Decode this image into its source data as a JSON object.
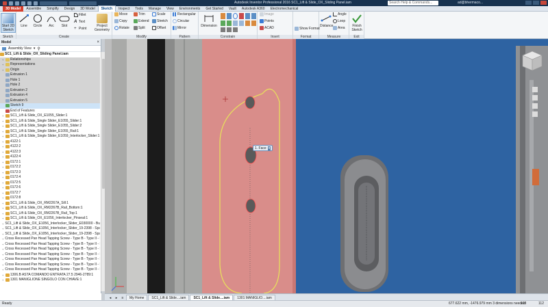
{
  "title_bar": {
    "title": "Autodesk Inventor Professional 2016  SC1_Lift & Slide_OX_Sliding Panel.iam",
    "search_placeholder": "Search Help & Commands...",
    "user": "ad@bhermaco..."
  },
  "ribbon_tabs": [
    "3D Model",
    "Assemble",
    "Simplify",
    "Design",
    "3D Model",
    "Sketch",
    "Inspect",
    "Tools",
    "Manage",
    "View",
    "Environments",
    "Get Started",
    "Vault",
    "Autodesk A360",
    "Electromechanical"
  ],
  "active_tab_index": 5,
  "panels": {
    "sketch": {
      "label": "Sketch",
      "start_button": "Start 2D Sketch"
    },
    "create": {
      "label": "Create",
      "line": "Line",
      "circle": "Circle",
      "arc": "Arc",
      "slot": "Slot",
      "fillet": "Fillet",
      "text": "Text",
      "point": "Point",
      "project_geometry": "Project Geometry"
    },
    "modify": {
      "label": "Modify",
      "move": "Move",
      "copy": "Copy",
      "rotate": "Rotate",
      "trim": "Trim",
      "extend": "Extend",
      "split": "Split",
      "scale": "Scale",
      "stretch": "Stretch",
      "offset": "Offset"
    },
    "pattern": {
      "label": "Pattern",
      "rectangular": "Rectangular",
      "circular": "Circular",
      "mirror": "Mirror"
    },
    "constrain": {
      "label": "Constrain",
      "dimension": "Dimension"
    },
    "insert": {
      "label": "Insert",
      "image": "Image",
      "points": "Points",
      "acad": "ACAD"
    },
    "format": {
      "label": "Format",
      "show_format": "Show Format"
    },
    "measure": {
      "label": "Measure",
      "distance": "Distance",
      "angle": "Angle",
      "loop": "Loop",
      "area": "Area"
    },
    "exit": {
      "label": "Exit",
      "finish": "Finish Sketch"
    }
  },
  "browser": {
    "panel_title": "Model",
    "view_dropdown": "Assembly View",
    "root": "SC1_Lift & Slide_OX_Sliding Panel.iam",
    "items": [
      {
        "label": "Relationships",
        "level": 1,
        "icon": "folder"
      },
      {
        "label": "Representations",
        "level": 1,
        "icon": "folder"
      },
      {
        "label": "Origin",
        "level": 1,
        "icon": "folder"
      },
      {
        "label": "Extrusion 1",
        "level": 1,
        "icon": "extrusion"
      },
      {
        "label": "Hole 1",
        "level": 1,
        "icon": "hole"
      },
      {
        "label": "Hole 2",
        "level": 1,
        "icon": "hole"
      },
      {
        "label": "Extrusion 2",
        "level": 1,
        "icon": "extrusion"
      },
      {
        "label": "Extrusion 4",
        "level": 1,
        "icon": "extrusion"
      },
      {
        "label": "Extrusion 5",
        "level": 1,
        "icon": "extrusion"
      },
      {
        "label": "Sketch 9",
        "level": 1,
        "icon": "sketch",
        "selected": true
      },
      {
        "label": "End of Features",
        "level": 1,
        "icon": "end"
      },
      {
        "label": "SC1_Lift & Slide_OX_E1055_Slider:1",
        "level": 1,
        "icon": "part"
      },
      {
        "label": "SC1_Lift & Slide_Single Slider_E1055_Slider:1",
        "level": 1,
        "icon": "part"
      },
      {
        "label": "SC1_Lift & Slide_Single Slider_E1055_Slider:2",
        "level": 1,
        "icon": "part"
      },
      {
        "label": "SC1_Lift & Slide_Single Slider_E1055_Rail:1",
        "level": 1,
        "icon": "part"
      },
      {
        "label": "SC1_Lift & Slide_Single Slider_E1059_Interlocker_Slider:1",
        "level": 1,
        "icon": "part"
      },
      {
        "label": "4122:1",
        "level": 1,
        "icon": "part"
      },
      {
        "label": "4122:2",
        "level": 1,
        "icon": "part"
      },
      {
        "label": "4122:3",
        "level": 1,
        "icon": "part"
      },
      {
        "label": "4122:4",
        "level": 1,
        "icon": "part"
      },
      {
        "label": "0172:1",
        "level": 1,
        "icon": "part"
      },
      {
        "label": "0172:2",
        "level": 1,
        "icon": "part"
      },
      {
        "label": "0172:3",
        "level": 1,
        "icon": "part"
      },
      {
        "label": "0172:4",
        "level": 1,
        "icon": "part"
      },
      {
        "label": "0172:5",
        "level": 1,
        "icon": "part"
      },
      {
        "label": "0172:6",
        "level": 1,
        "icon": "part"
      },
      {
        "label": "0172:7",
        "level": 1,
        "icon": "part"
      },
      {
        "label": "0172:8",
        "level": 1,
        "icon": "part"
      },
      {
        "label": "SC1_Lift & Slide_OX_RM2267A_Sill:1",
        "level": 1,
        "icon": "part"
      },
      {
        "label": "SC1_Lift & Slide_OX_RM2267B_Rail_Bottom:1",
        "level": 1,
        "icon": "part"
      },
      {
        "label": "SC1_Lift & Slide_OX_RM2267B_Rail_Top:1",
        "level": 1,
        "icon": "part"
      },
      {
        "label": "SC1_Lift & Slide_OX_E1056_Interlocker_Pinseal:1",
        "level": 1,
        "icon": "part"
      },
      {
        "label": "SC1_Lift & Slide_OX_E1056_Interlocker_Slider_E030000 - Bulb",
        "level": 1,
        "icon": "part"
      },
      {
        "label": "SC1_Lift & Slide_OX_E1056_Interlocker_Slider_19-2398 - Space",
        "level": 1,
        "icon": "part"
      },
      {
        "label": "SC1_Lift & Slide_OX_E1056_Interlocker_Slider_19-2398 - Space",
        "level": 1,
        "icon": "part"
      },
      {
        "label": "Cross Recessed Pan Head Tapping Screw - Type B - Type II - H",
        "level": 1,
        "icon": "screw"
      },
      {
        "label": "Cross Recessed Pan Head Tapping Screw - Type B - Type II - H",
        "level": 1,
        "icon": "screw"
      },
      {
        "label": "Cross Recessed Pan Head Tapping Screw - Type B - Type II - H",
        "level": 1,
        "icon": "screw"
      },
      {
        "label": "Cross Recessed Pan Head Tapping Screw - Type B - Type II - H",
        "level": 1,
        "icon": "screw"
      },
      {
        "label": "Cross Recessed Pan Head Tapping Screw - Type B - Type II - H",
        "level": 1,
        "icon": "screw"
      },
      {
        "label": "Cross Recessed Pan Head Tapping Screw - Type B - Type II - H",
        "level": 1,
        "icon": "screw"
      },
      {
        "label": "Cross Recessed Pan Head Tapping Screw - Type B - Type II - H",
        "level": 1,
        "icon": "screw"
      },
      {
        "label": "1306.B ASTA COMANDO ENTRATA 27.5 2946-2789:1",
        "level": 1,
        "icon": "part"
      },
      {
        "label": "1301 MANIGLIONE SINGOLO CON CHIAVE:1",
        "level": 1,
        "icon": "part"
      }
    ]
  },
  "viewport": {
    "face_tag": "1. Face"
  },
  "doc_tabs": [
    "My Home",
    "SC1_Lift & Slide....iam",
    "SC1_Lift & Slide....iam",
    "1301 MANIGLIO....iam"
  ],
  "active_doc_tab_index": 2,
  "status": {
    "ready": "Ready",
    "coords": "677.622 mm, -1476.979 mm   3 dimensions needed",
    "n1": "103",
    "n2": "112"
  },
  "colors": {
    "titlebar": "#17324f",
    "viewport_bg": "#2e63a2",
    "panel_red": "#d98d8a",
    "sketch_yellow": "#e8e45a",
    "tab_accent": "#d6402e"
  }
}
